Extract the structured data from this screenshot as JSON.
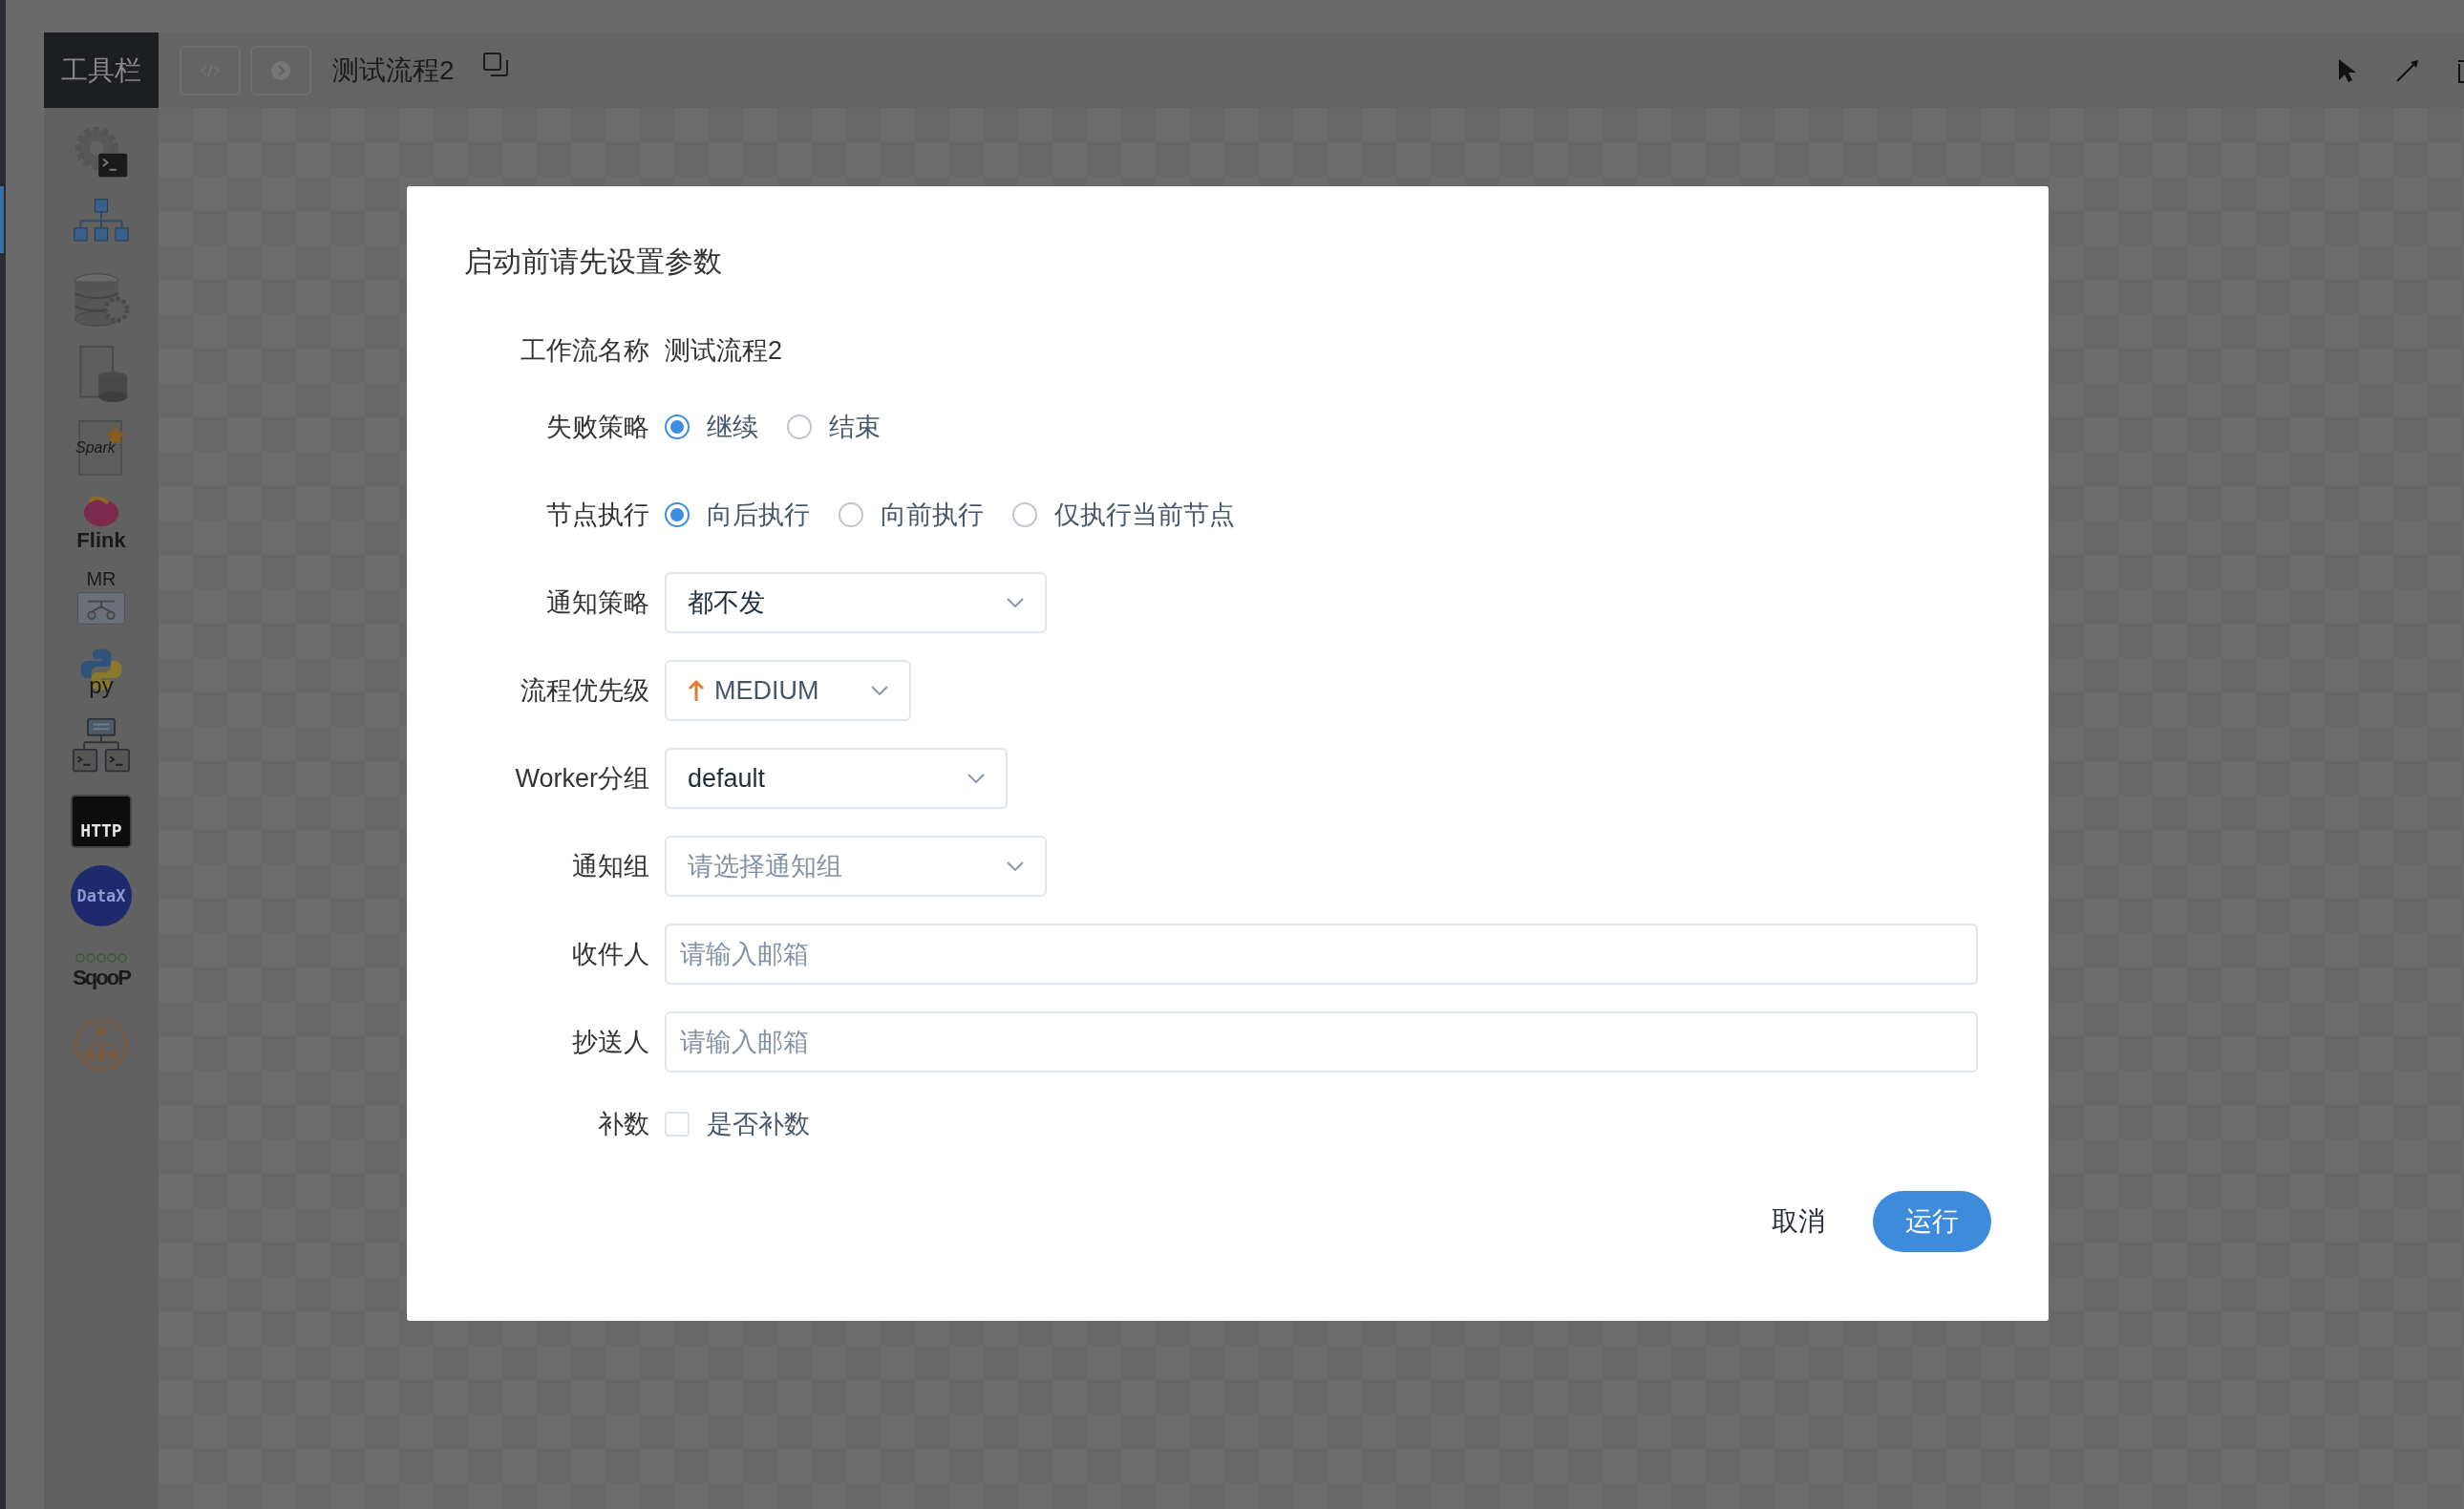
{
  "toolbar": {
    "title": "工具栏"
  },
  "header": {
    "title": "测试流程2"
  },
  "tools": [
    {
      "kind": "shell"
    },
    {
      "kind": "subprocess"
    },
    {
      "kind": "procedure"
    },
    {
      "kind": "sql"
    },
    {
      "kind": "spark",
      "label": "Spark"
    },
    {
      "kind": "flink",
      "label": "Flink"
    },
    {
      "kind": "mr",
      "label": "MR"
    },
    {
      "kind": "python",
      "label": "py"
    },
    {
      "kind": "dependent"
    },
    {
      "kind": "http",
      "label": "HTTP"
    },
    {
      "kind": "datax",
      "label": "DataX"
    },
    {
      "kind": "sqoop",
      "label": "SqooP"
    },
    {
      "kind": "conditions"
    }
  ],
  "dialog": {
    "title": "启动前请先设置参数",
    "fields": [
      {
        "kind": "text",
        "label": "工作流名称",
        "value": "测试流程2"
      },
      {
        "kind": "radio",
        "label": "失败策略",
        "options": [
          {
            "label": "继续",
            "selected": true
          },
          {
            "label": "结束",
            "selected": false
          }
        ]
      },
      {
        "kind": "radio",
        "label": "节点执行",
        "options": [
          {
            "label": "向后执行",
            "selected": true
          },
          {
            "label": "向前执行",
            "selected": false
          },
          {
            "label": "仅执行当前节点",
            "selected": false
          }
        ]
      },
      {
        "kind": "select",
        "label": "通知策略",
        "value": "都不发"
      },
      {
        "kind": "priority",
        "label": "流程优先级",
        "value": "MEDIUM"
      },
      {
        "kind": "select",
        "label": "Worker分组",
        "value": "default"
      },
      {
        "kind": "select",
        "label": "通知组",
        "placeholder": "请选择通知组"
      },
      {
        "kind": "input",
        "label": "收件人",
        "placeholder": "请输入邮箱"
      },
      {
        "kind": "input",
        "label": "抄送人",
        "placeholder": "请输入邮箱"
      },
      {
        "kind": "checkbox",
        "label": "补数",
        "option": "是否补数",
        "checked": false
      }
    ],
    "buttons": [
      {
        "kind": "text",
        "label": "取消"
      },
      {
        "kind": "primary",
        "label": "运行"
      }
    ]
  }
}
